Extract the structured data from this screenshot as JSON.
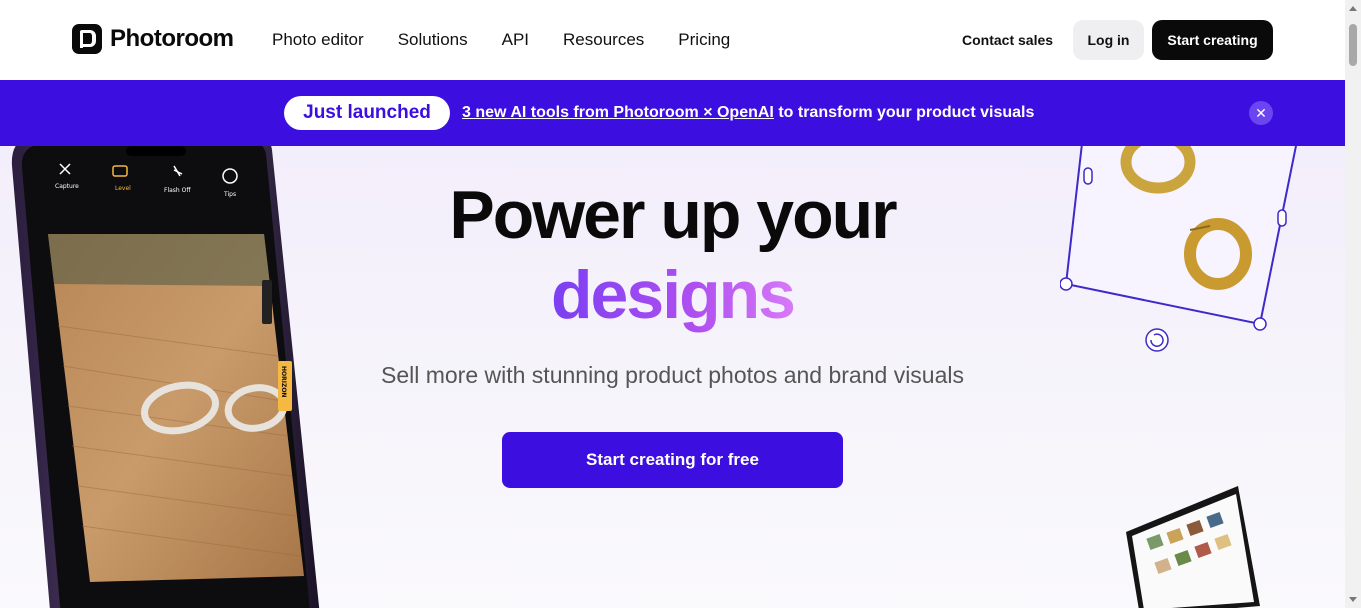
{
  "header": {
    "brand": "Photoroom",
    "nav": [
      "Photo editor",
      "Solutions",
      "API",
      "Resources",
      "Pricing"
    ],
    "contact_sales": "Contact sales",
    "log_in": "Log in",
    "start_creating": "Start creating"
  },
  "banner": {
    "badge": "Just launched",
    "link_text": "3 new AI tools from Photoroom × OpenAI",
    "rest_text": " to transform your product visuals",
    "close_icon": "close-icon"
  },
  "hero": {
    "title_line1": "Power up your",
    "title_line2": "designs",
    "subtitle": "Sell more with stunning product photos and brand visuals",
    "cta": "Start creating for free",
    "phone_labels": [
      "Capture",
      "Level",
      "Flash Off",
      "Tips"
    ],
    "phone_tag": "HORIZON"
  },
  "colors": {
    "accent": "#3d0ee0",
    "gradient_start": "#7b3ff2",
    "gradient_end": "#d77af7"
  }
}
